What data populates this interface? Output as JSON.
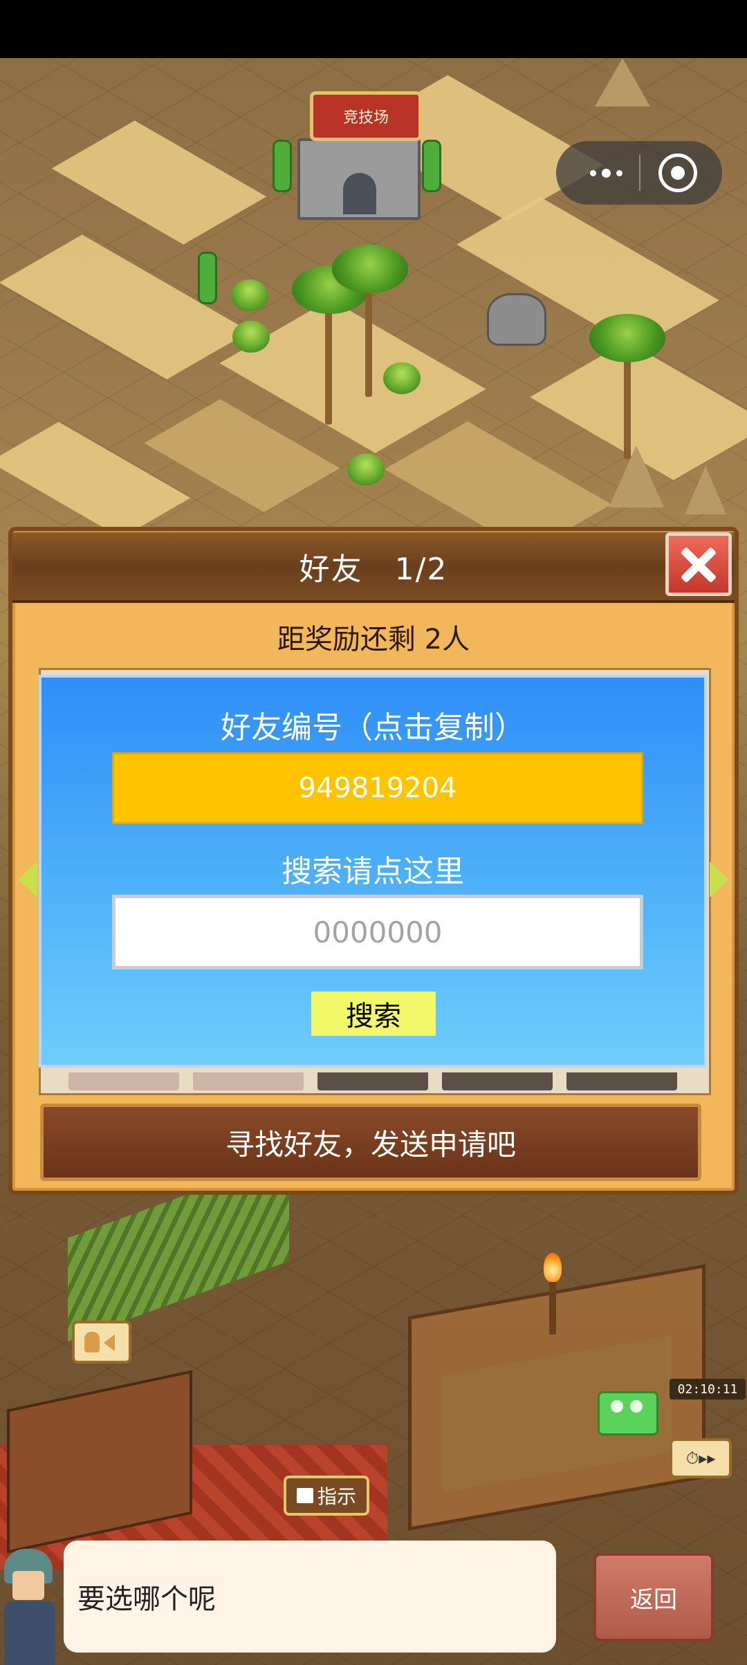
{
  "map": {
    "arena_sign": "竞技场"
  },
  "capsule": {
    "more_icon": "more-dots-icon",
    "close_icon": "target-close-icon"
  },
  "friends_panel": {
    "title": "好友　1/2",
    "reward_text": "距奖励还剩 2人",
    "close_icon": "close-x-icon",
    "find_friends_text": "寻找好友，发送申请吧"
  },
  "search_dialog": {
    "friend_id_title": "好友编号（点击复制）",
    "friend_id": "949819204",
    "search_hint": "搜索请点这里",
    "search_placeholder": "0000000",
    "search_button": "搜索"
  },
  "hud": {
    "guide_label": "指示",
    "timer": "02:10:11",
    "speed_icon": "clock-fast-forward-icon"
  },
  "bottom": {
    "dialogue": "要选哪个呢",
    "back_label": "返回"
  }
}
